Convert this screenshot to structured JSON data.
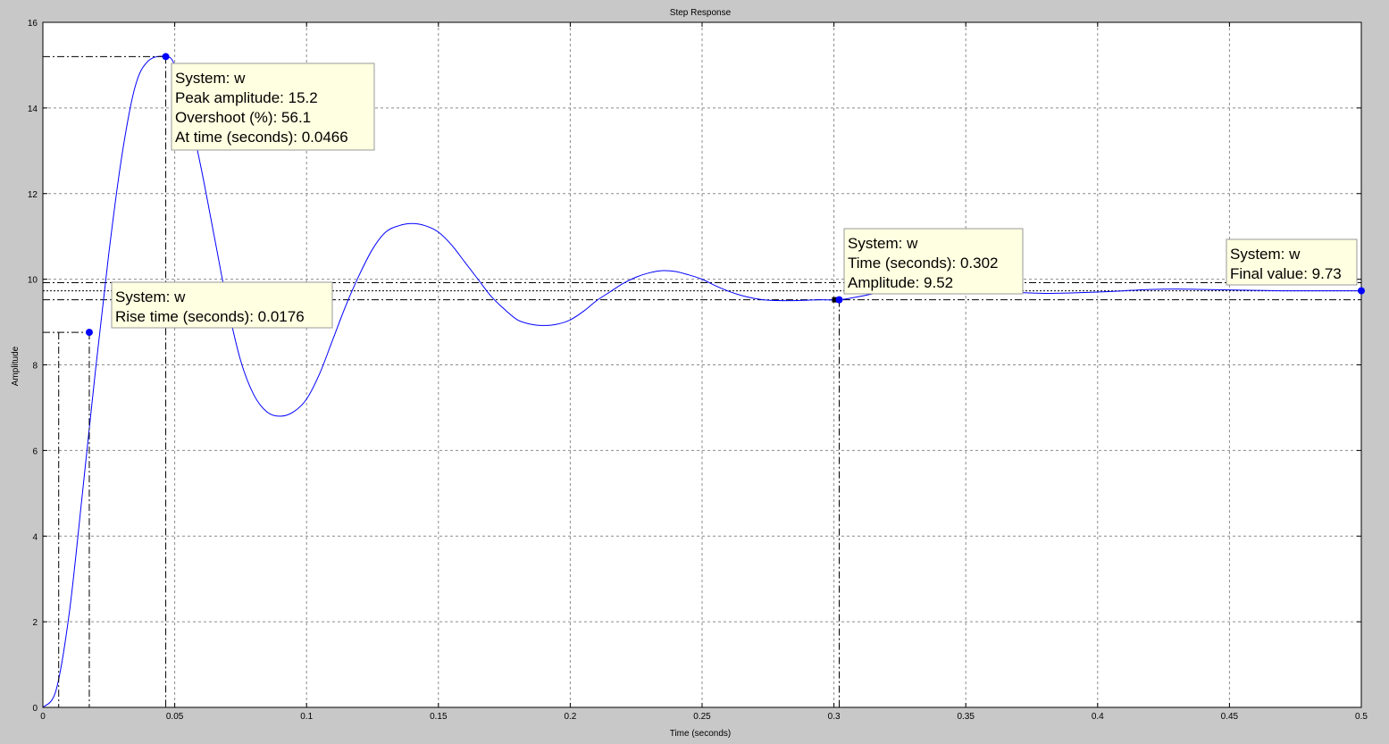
{
  "chart_data": {
    "type": "line",
    "title": "Step Response",
    "xlabel": "Time (seconds)",
    "ylabel": "Amplitude",
    "xlim": [
      0,
      0.5
    ],
    "ylim": [
      0,
      16
    ],
    "grid": true,
    "x_ticks": [
      "0",
      "0.05",
      "0.1",
      "0.15",
      "0.2",
      "0.25",
      "0.3",
      "0.35",
      "0.4",
      "0.45",
      "0.5"
    ],
    "y_ticks": [
      "0",
      "2",
      "4",
      "6",
      "8",
      "10",
      "12",
      "14",
      "16"
    ],
    "line_color": "#0000ff",
    "series": [
      {
        "name": "w",
        "x": [
          0,
          0.005,
          0.01,
          0.015,
          0.02,
          0.025,
          0.03,
          0.035,
          0.04,
          0.0466,
          0.05,
          0.055,
          0.06,
          0.065,
          0.07,
          0.075,
          0.08,
          0.085,
          0.09,
          0.095,
          0.1,
          0.105,
          0.11,
          0.115,
          0.12,
          0.125,
          0.13,
          0.135,
          0.14,
          0.145,
          0.15,
          0.155,
          0.16,
          0.165,
          0.17,
          0.175,
          0.18,
          0.185,
          0.19,
          0.195,
          0.2,
          0.205,
          0.21,
          0.215,
          0.22,
          0.225,
          0.23,
          0.235,
          0.24,
          0.245,
          0.25,
          0.255,
          0.26,
          0.265,
          0.27,
          0.275,
          0.28,
          0.285,
          0.29,
          0.295,
          0.302,
          0.31,
          0.32,
          0.33,
          0.34,
          0.35,
          0.36,
          0.37,
          0.38,
          0.39,
          0.4,
          0.41,
          0.42,
          0.43,
          0.44,
          0.45,
          0.46,
          0.47,
          0.48,
          0.49,
          0.5
        ],
        "y": [
          0,
          0.4,
          2.2,
          5.0,
          7.9,
          10.6,
          12.9,
          14.5,
          15.1,
          15.2,
          15.0,
          14.0,
          12.6,
          11.0,
          9.4,
          8.1,
          7.3,
          6.9,
          6.8,
          6.9,
          7.2,
          7.8,
          8.6,
          9.4,
          10.1,
          10.7,
          11.1,
          11.25,
          11.3,
          11.25,
          11.1,
          10.8,
          10.4,
          10.0,
          9.6,
          9.3,
          9.05,
          8.95,
          8.92,
          8.95,
          9.05,
          9.25,
          9.5,
          9.7,
          9.9,
          10.05,
          10.15,
          10.2,
          10.18,
          10.1,
          10.0,
          9.85,
          9.72,
          9.62,
          9.55,
          9.51,
          9.5,
          9.5,
          9.51,
          9.52,
          9.52,
          9.6,
          9.72,
          9.8,
          9.82,
          9.79,
          9.74,
          9.69,
          9.67,
          9.68,
          9.7,
          9.73,
          9.76,
          9.77,
          9.76,
          9.75,
          9.74,
          9.73,
          9.73,
          9.73,
          9.73
        ]
      }
    ],
    "markers": [
      {
        "kind": "peak",
        "x": 0.0466,
        "y": 15.2
      },
      {
        "kind": "rise",
        "x": 0.0176,
        "y": 8.76,
        "x_start": 0.006
      },
      {
        "kind": "settling",
        "x": 0.302,
        "y": 9.52
      },
      {
        "kind": "final",
        "x": 0.5,
        "y": 9.73
      }
    ],
    "reference_lines_y": [
      9.73,
      9.92,
      9.52
    ],
    "annotations": {
      "peak": [
        "System: w",
        "Peak amplitude: 15.2",
        "Overshoot (%): 56.1",
        "At time (seconds): 0.0466"
      ],
      "rise": [
        "System: w",
        "Rise time (seconds): 0.0176"
      ],
      "settling": [
        "System: w",
        "Time (seconds): 0.302",
        "Amplitude: 9.52"
      ],
      "final": [
        "System: w",
        "Final value: 9.73"
      ]
    }
  }
}
